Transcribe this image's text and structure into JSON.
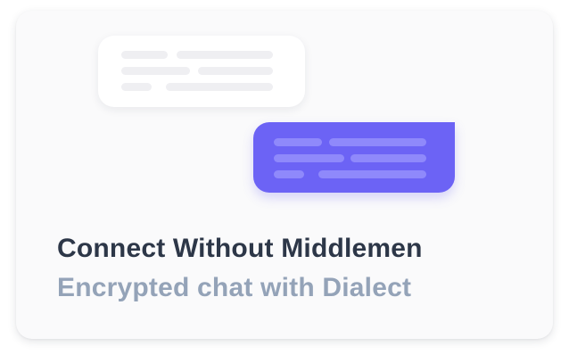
{
  "card": {
    "title": "Connect Without Middlemen",
    "subtitle": "Encrypted chat with Dialect"
  },
  "colors": {
    "title": "#2d3748",
    "subtitle": "#94a3b8",
    "outgoing_bubble": "#6c63f5",
    "incoming_bubble": "#ffffff"
  }
}
